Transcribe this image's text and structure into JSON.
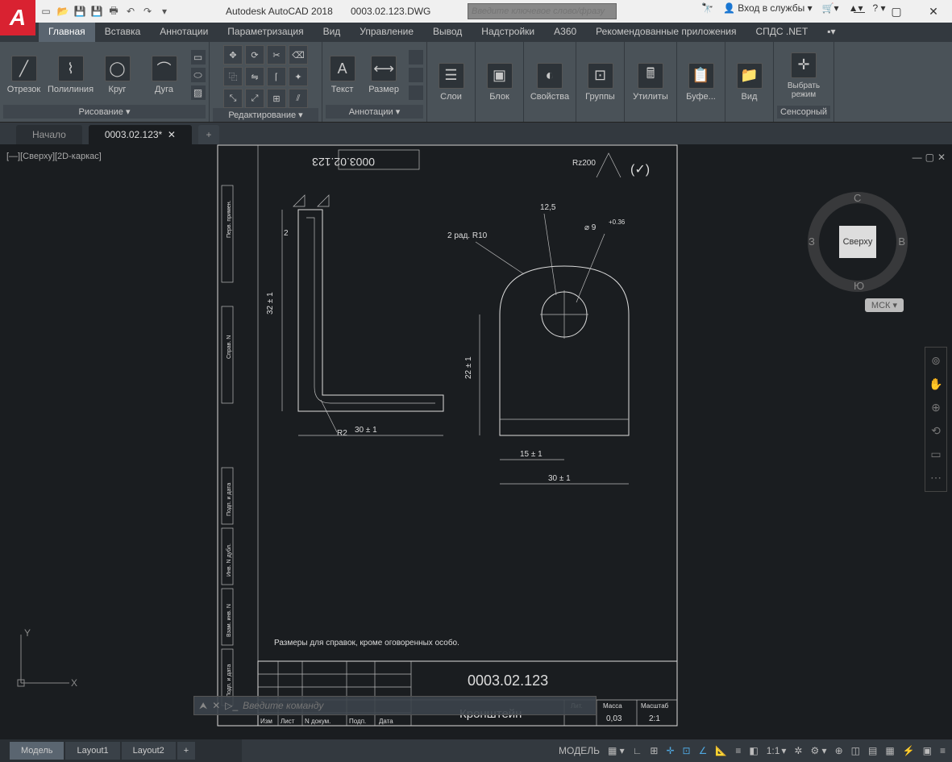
{
  "title": {
    "app": "Autodesk AutoCAD 2018",
    "file": "0003.02.123.DWG"
  },
  "search_placeholder": "Введите ключевое слово/фразу",
  "login": "Вход в службы",
  "menutabs": [
    "Главная",
    "Вставка",
    "Аннотации",
    "Параметризация",
    "Вид",
    "Управление",
    "Вывод",
    "Надстройки",
    "A360",
    "Рекомендованные приложения",
    "СПДС .NET"
  ],
  "ribbon": {
    "draw": {
      "title": "Рисование ▾",
      "items": [
        "Отрезок",
        "Полилиния",
        "Круг",
        "Дуга"
      ]
    },
    "edit": {
      "title": "Редактирование ▾"
    },
    "annot": {
      "title": "Аннотации ▾",
      "items": [
        "Текст",
        "Размер"
      ]
    },
    "layers": {
      "title": "",
      "btn": "Слои"
    },
    "block": {
      "title": "",
      "btn": "Блок"
    },
    "props": {
      "title": "",
      "btn": "Свойства"
    },
    "groups": {
      "title": "",
      "btn": "Группы"
    },
    "utils": {
      "title": "",
      "btn": "Утилиты"
    },
    "clip": {
      "title": "",
      "btn": "Буфе..."
    },
    "view": {
      "title": "",
      "btn": "Вид"
    },
    "mode": {
      "title": "Сенсорный",
      "btn": "Выбрать режим"
    }
  },
  "filetabs": {
    "start": "Начало",
    "current": "0003.02.123*"
  },
  "viewport_label": "[—][Сверху][2D-каркас]",
  "viewcube": {
    "face": "Сверху",
    "n": "С",
    "s": "Ю",
    "e": "В",
    "w": "З",
    "wcs": "МСК ▾"
  },
  "drawing": {
    "number": "0003.02.123",
    "number_rev": "0003.02.123",
    "part_name": "Кронштейн",
    "note": "Размеры для справок, кроме оговоренных особо.",
    "roughness": "Rz200",
    "dims": {
      "h": "32 ± 1",
      "w1": "30 ± 1",
      "r": "R2",
      "off": "2",
      "h2": "22 ± 1",
      "w2": "15 ± 1",
      "w3": "30 ± 1",
      "hole": "⌀ 9",
      "tol": "+0.36",
      "край": "12,5",
      "rad": "2 рад. R10"
    },
    "tb": {
      "изм": "Изм",
      "лист": "Лист",
      "ндокум": "N докум.",
      "подп": "Подп.",
      "дата": "Дата",
      "лит": "Лит.",
      "масса": "Масса",
      "масштаб": "Масштаб",
      "mass_val": "0,03",
      "scale_val": "2:1"
    },
    "side_labels": [
      "Перв. примен.",
      "Справ. N",
      "Подп. и дата",
      "Инв. N дубл.",
      "Взам. инв. N",
      "Подп. и дата"
    ]
  },
  "cmd_placeholder": "Введите команду",
  "bottom_tabs": [
    "Модель",
    "Layout1",
    "Layout2"
  ],
  "status": {
    "space": "МОДЕЛЬ",
    "scale": "1:1"
  }
}
